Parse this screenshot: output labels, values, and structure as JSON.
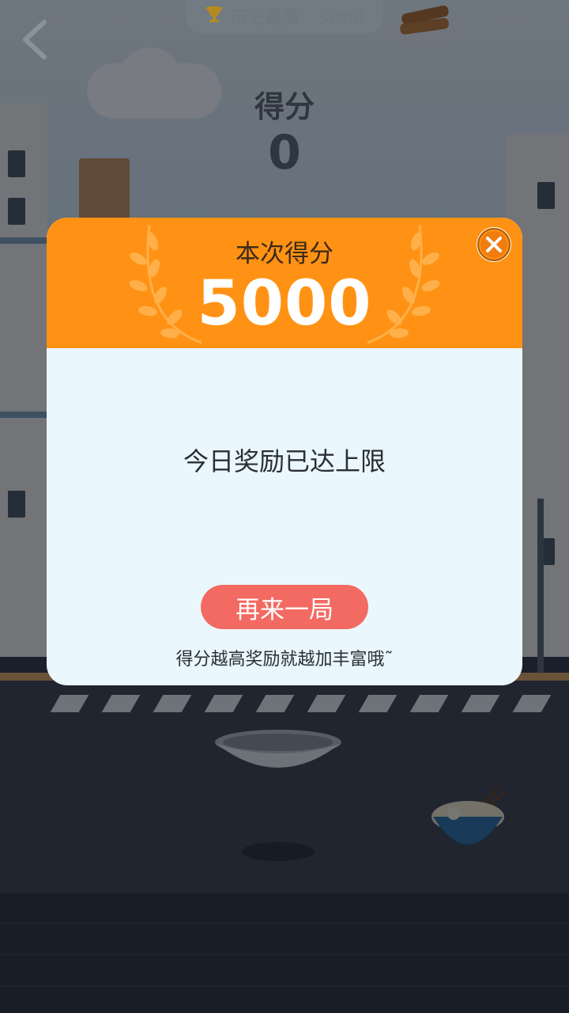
{
  "header": {
    "best_label": "历史最高：5000",
    "score_title": "得分",
    "score_value": "0"
  },
  "modal": {
    "subtitle": "本次得分",
    "score": "5000",
    "message": "今日奖励已达上限",
    "again_button": "再来一局",
    "hint": "得分越高奖励就越加丰富哦˜"
  },
  "icons": {
    "back": "chevron-left-icon",
    "trophy": "trophy-icon",
    "close": "close-icon",
    "laurel": "laurel-icon"
  },
  "colors": {
    "header_orange": "#ff9214",
    "button_red": "#f36a62",
    "panel_bg": "#eaf7fc"
  }
}
